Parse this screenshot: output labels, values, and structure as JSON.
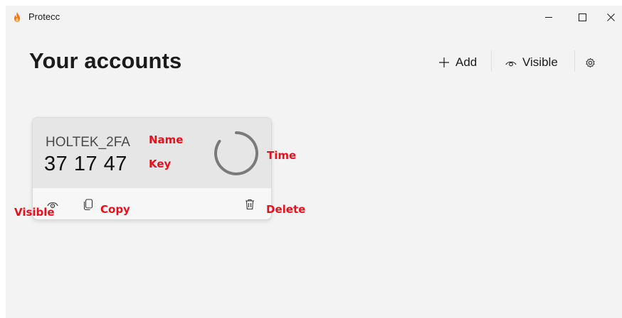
{
  "window": {
    "app_title": "Protecc",
    "accent_color": "#e8101c"
  },
  "header": {
    "title": "Your accounts",
    "add_label": "Add",
    "visible_label": "Visible"
  },
  "card": {
    "account_name": "HOLTEK_2FA",
    "key": "37 17 47",
    "timer_remaining_fraction": 0.85
  },
  "annotations": {
    "name": "Name",
    "key": "Key",
    "time": "Time",
    "visible": "Visible",
    "copy": "Copy",
    "delete": "Delete"
  },
  "icons": {
    "app": "flame-icon",
    "add": "plus-icon",
    "visible": "eye-icon",
    "settings": "gear-icon",
    "copy": "copy-icon",
    "delete": "trash-icon"
  }
}
